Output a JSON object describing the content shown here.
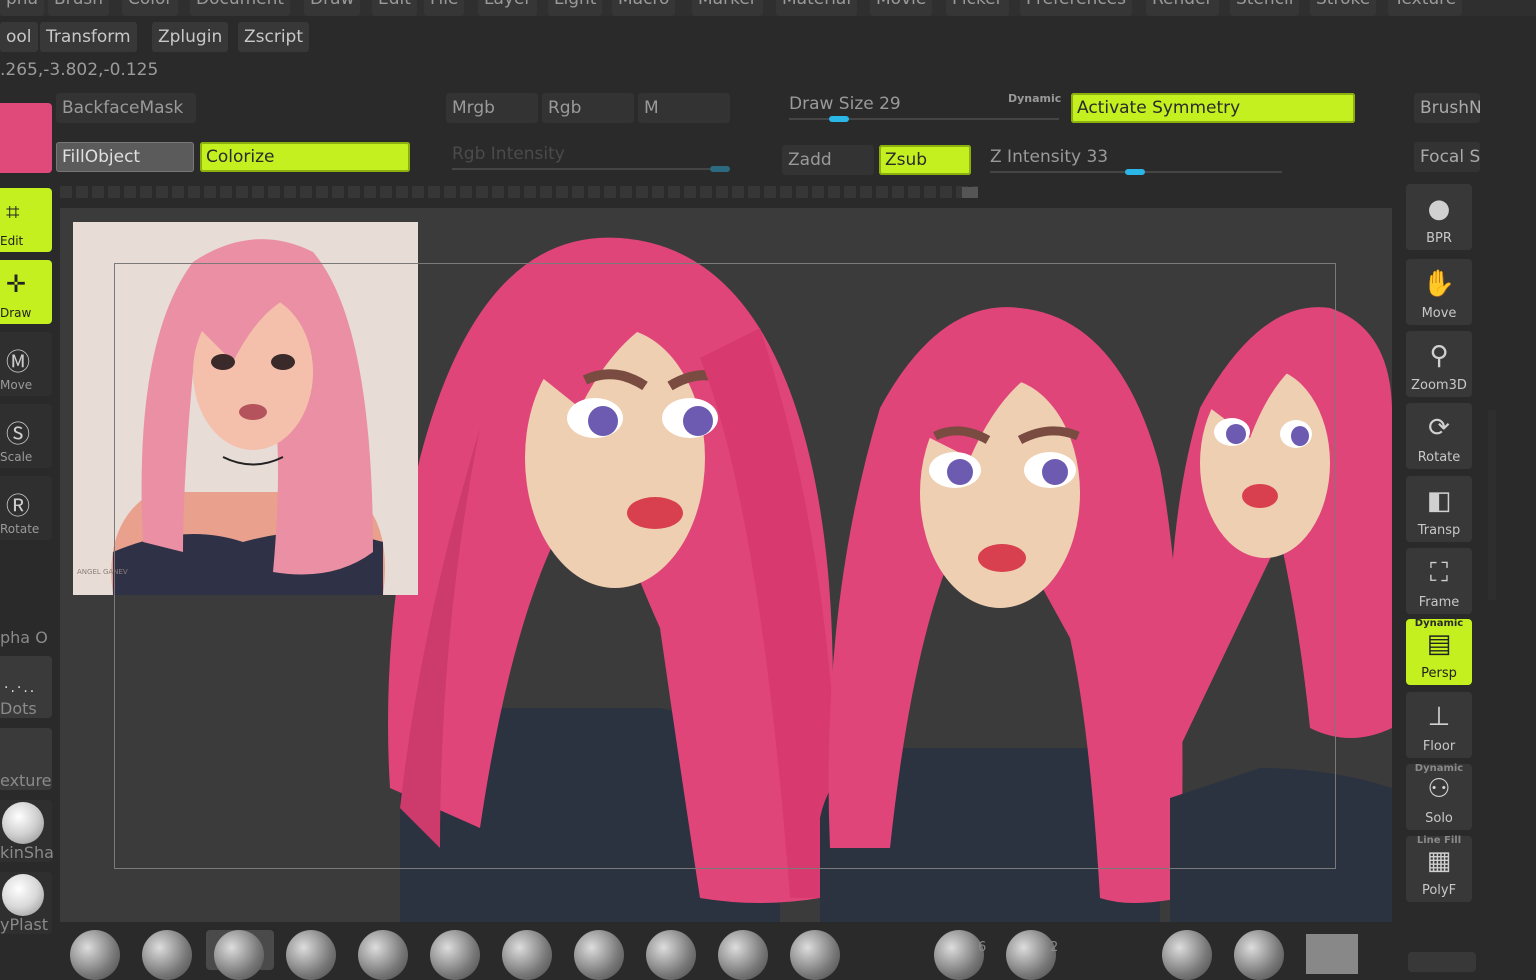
{
  "menu": [
    "pha",
    "Brush",
    "Color",
    "Document",
    "Draw",
    "Edit",
    "File",
    "Layer",
    "Light",
    "Macro",
    "Marker",
    "Material",
    "Movie",
    "Picker",
    "Preferences",
    "Render",
    "Stencil",
    "Stroke",
    "Texture"
  ],
  "submenu": [
    "ool",
    "Transform",
    "Zplugin",
    "Zscript"
  ],
  "coordinates": ".265,-3.802,-0.125",
  "toolbar": {
    "backface_mask": "BackfaceMask",
    "fill_object": "FillObject",
    "colorize": "Colorize",
    "mrgb": "Mrgb",
    "rgb": "Rgb",
    "m": "M",
    "rgb_intensity": "Rgb Intensity",
    "draw_size_label": "Draw Size",
    "draw_size_value": "29",
    "dynamic": "Dynamic",
    "activate_symmetry": "Activate Symmetry",
    "zadd": "Zadd",
    "zsub": "Zsub",
    "z_intensity_label": "Z Intensity",
    "z_intensity_value": "33",
    "brush_cut": "BrushN",
    "focal_cut": "Focal S"
  },
  "left_tools": [
    {
      "label": "Edit",
      "icon": "edit-icon",
      "active": true
    },
    {
      "label": "Draw",
      "icon": "draw-icon",
      "active": true
    },
    {
      "label": "Move",
      "icon": "move-icon",
      "active": false
    },
    {
      "label": "Scale",
      "icon": "scale-icon",
      "active": false
    },
    {
      "label": "Rotate",
      "icon": "rotate-icon",
      "active": false
    }
  ],
  "left_materials": {
    "alpha": "pha O",
    "dots": "Dots",
    "texture": "exture",
    "skin": "kinSha",
    "poly": "yPlast"
  },
  "right_tools": [
    {
      "label": "BPR",
      "icon": "bpr-icon",
      "active": false,
      "sup": ""
    },
    {
      "label": "Move",
      "icon": "hand-icon",
      "active": false,
      "sup": ""
    },
    {
      "label": "Zoom3D",
      "icon": "zoom-icon",
      "active": false,
      "sup": ""
    },
    {
      "label": "Rotate",
      "icon": "rotate3d-icon",
      "active": false,
      "sup": ""
    },
    {
      "label": "Transp",
      "icon": "transp-icon",
      "active": false,
      "sup": ""
    },
    {
      "label": "Frame",
      "icon": "frame-icon",
      "active": false,
      "sup": ""
    },
    {
      "label": "Persp",
      "icon": "persp-icon",
      "active": true,
      "sup": "Dynamic"
    },
    {
      "label": "Floor",
      "icon": "floor-icon",
      "active": false,
      "sup": ""
    },
    {
      "label": "Solo",
      "icon": "solo-icon",
      "active": false,
      "sup": "Dynamic"
    },
    {
      "label": "PolyF",
      "icon": "polyf-icon",
      "active": false,
      "sup": "Line Fill"
    }
  ],
  "signature": "ANGEL GANEV",
  "shelf_counts": {
    "a": "6",
    "b": "2"
  },
  "colors": {
    "accent": "#c3f01e",
    "hair": "#e0457a",
    "slider": "#2bb6e8"
  }
}
